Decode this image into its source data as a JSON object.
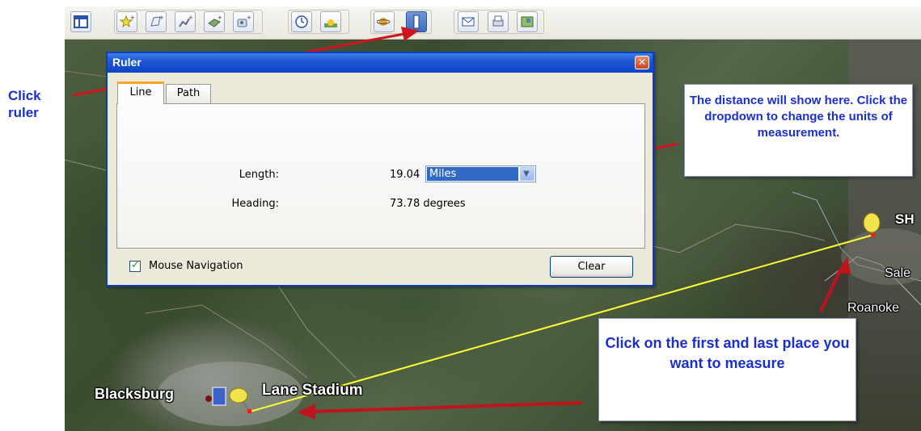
{
  "annotation": {
    "click_ruler": "Click ruler",
    "distance_note": "The distance will show here. Click the dropdown to change the units of measurement.",
    "click_points_note": "Click on the first and last place you want to measure"
  },
  "ruler_dialog": {
    "title": "Ruler",
    "close_glyph": "✕",
    "tabs": [
      {
        "label": "Line"
      },
      {
        "label": "Path"
      }
    ],
    "length_label": "Length:",
    "length_value": "19.04",
    "units_selected": "Miles",
    "heading_label": "Heading:",
    "heading_value": "73.78 degrees",
    "mouse_navigation_label": "Mouse Navigation",
    "mouse_navigation_checked": true,
    "clear_label": "Clear"
  },
  "map_labels": {
    "blacksburg": "Blacksburg",
    "lane_stadium": "Lane Stadium",
    "sh": "SH",
    "sale": "Sale",
    "roanoke": "Roanoke"
  },
  "toolbar": {
    "buttons": [
      {
        "icon": "sidebar-icon"
      },
      {
        "icon": "add-placemark-icon"
      },
      {
        "icon": "add-polygon-icon"
      },
      {
        "icon": "add-path-icon"
      },
      {
        "icon": "add-image-overlay-icon"
      },
      {
        "icon": "record-tour-icon"
      },
      {
        "icon": "historical-imagery-icon"
      },
      {
        "icon": "sunlight-icon"
      },
      {
        "icon": "planets-icon"
      },
      {
        "icon": "ruler-icon"
      },
      {
        "icon": "email-icon"
      },
      {
        "icon": "print-icon"
      },
      {
        "icon": "view-in-maps-icon"
      }
    ]
  },
  "colors": {
    "annotation_text": "#1a2fd0",
    "arrow_red": "#d0141e",
    "measure_line": "#ffff33",
    "dialog_title": "#0c45c4"
  }
}
